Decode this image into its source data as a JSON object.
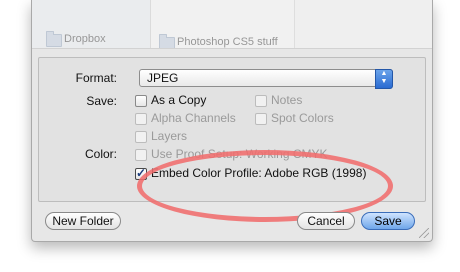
{
  "browser": {
    "sidebar_item": "Dropbox",
    "folder_item": "Photoshop CS5 stuff"
  },
  "form": {
    "format_label": "Format:",
    "format_value": "JPEG",
    "save_label": "Save:",
    "color_label": "Color:"
  },
  "save_options": [
    {
      "label": "As a Copy",
      "checked": false,
      "enabled": true
    },
    {
      "label": "Notes",
      "checked": false,
      "enabled": false
    },
    {
      "label": "Alpha Channels",
      "checked": false,
      "enabled": false
    },
    {
      "label": "Spot Colors",
      "checked": false,
      "enabled": false
    },
    {
      "label": "Layers",
      "checked": false,
      "enabled": false
    }
  ],
  "color_options": [
    {
      "label": "Use Proof Setup:  Working CMYK",
      "checked": false,
      "enabled": false
    },
    {
      "label": "Embed Color Profile:  Adobe RGB (1998)",
      "checked": true,
      "enabled": true
    }
  ],
  "buttons": {
    "new_folder": "New Folder",
    "cancel": "Cancel",
    "save": "Save"
  },
  "colors": {
    "highlight_ellipse": "#f06d6d",
    "default_button": "#6fa6ea"
  }
}
